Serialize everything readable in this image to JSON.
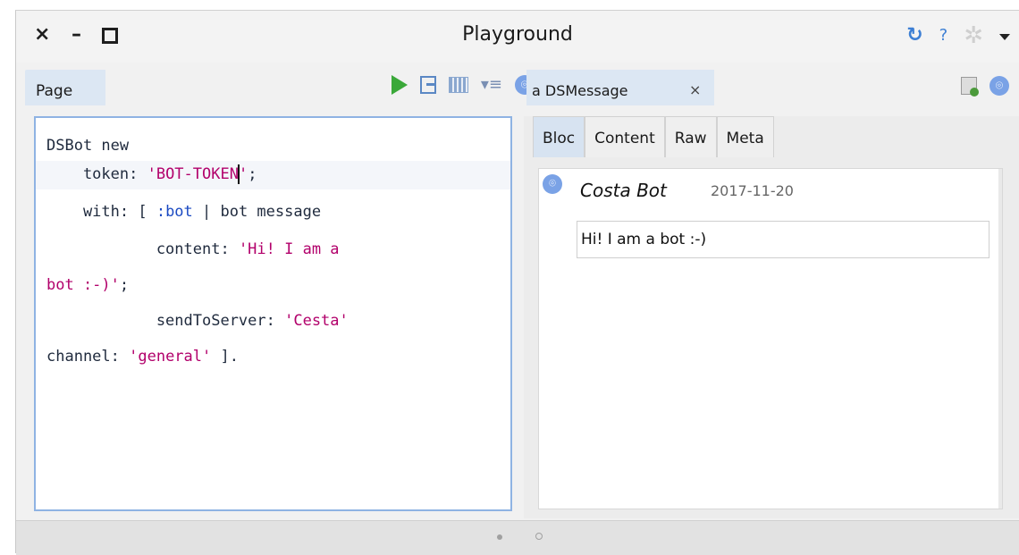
{
  "window": {
    "title": "Playground",
    "close_glyph": "×",
    "minimize_glyph": "–"
  },
  "titlebar_icons": [
    "refresh-icon",
    "help-icon",
    "gear-icon",
    "caret-down-icon"
  ],
  "titlebar_text": {
    "refresh": "↻",
    "help": "?",
    "gear": "✲"
  },
  "left_pane": {
    "tab_label": "Page",
    "toolbar_icons": [
      "play-icon",
      "do-it-icon",
      "inspect-columns-icon",
      "menu-icon",
      "discord-icon"
    ],
    "menu_glyph": "▾≡",
    "discord_glyph": "⌾"
  },
  "code": {
    "line1": "DSBot new",
    "line2_a": "    token: ",
    "line2_str1": "'BOT-TOKEN",
    "line2_str2": "'",
    "line2_end": ";",
    "line3_a": "    with: [ ",
    "line3_sym": ":bot",
    "line3_b": " | bot message",
    "line4_a": "            content: ",
    "line4_str": "'Hi! I am a",
    "line5_str": "bot :-)'",
    "line5_end": ";",
    "line6_a": "            sendToServer: ",
    "line6_str": "'Cesta'",
    "line7_a": "channel: ",
    "line7_str": "'general'",
    "line7_end": " ]."
  },
  "right_pane": {
    "tab_label": "a DSMessage",
    "tab_close": "×",
    "icons": [
      "edit-doc-icon",
      "discord-icon"
    ],
    "subtabs": [
      "Bloc",
      "Content",
      "Raw",
      "Meta"
    ],
    "active_subtab": "Bloc",
    "message": {
      "author": "Costa Bot",
      "date": "2017-11-20",
      "content": "Hi! I am a bot :-)"
    }
  },
  "status": {
    "pages": 2,
    "current": 1
  },
  "colors": {
    "accent": "#3d7fd4",
    "tab_active": "#dce7f3",
    "string": "#b2006b",
    "symbol": "#1b4ac2",
    "play": "#3aa839"
  }
}
